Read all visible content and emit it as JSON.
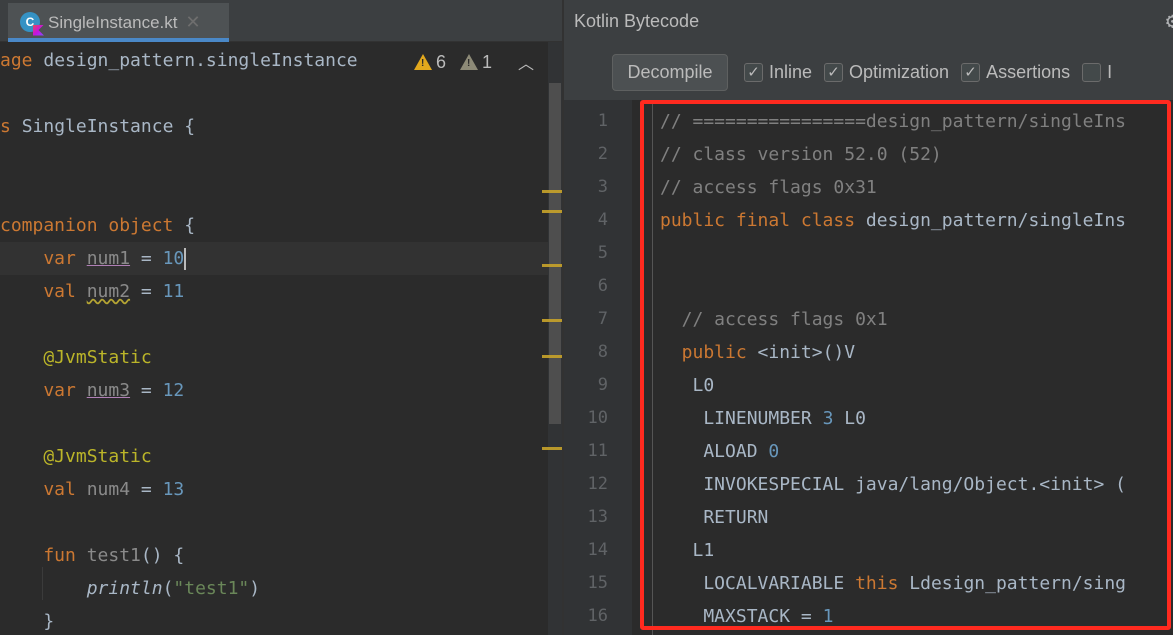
{
  "editor": {
    "tab": {
      "label": "SingleInstance.kt",
      "icon": "kotlin-class-file-icon",
      "close_icon": "close-icon"
    },
    "inspections": {
      "warnings": "6",
      "weak_warnings": "1"
    },
    "lines": [
      {
        "parts": [
          [
            "kw",
            "age "
          ],
          [
            "",
            "design_pattern.singleInstance"
          ]
        ]
      },
      {
        "parts": []
      },
      {
        "parts": [
          [
            "kw",
            "s "
          ],
          [
            "",
            "SingleInstance {"
          ]
        ]
      },
      {
        "parts": []
      },
      {
        "parts": []
      },
      {
        "parts": [
          [
            "kw",
            "companion object "
          ],
          [
            "",
            "{"
          ]
        ]
      },
      {
        "parts": [
          [
            "kw",
            "    var "
          ],
          [
            "num1",
            "num1"
          ],
          [
            "",
            " = "
          ],
          [
            "num",
            "10"
          ]
        ],
        "active": true
      },
      {
        "parts": [
          [
            "kw",
            "    val "
          ],
          [
            "num2",
            "num2"
          ],
          [
            "",
            " = "
          ],
          [
            "num",
            "11"
          ]
        ]
      },
      {
        "parts": []
      },
      {
        "parts": [
          [
            "ann",
            "    @JvmStatic"
          ]
        ]
      },
      {
        "parts": [
          [
            "kw",
            "    var "
          ],
          [
            "num3",
            "num3"
          ],
          [
            "",
            " = "
          ],
          [
            "num",
            "12"
          ]
        ]
      },
      {
        "parts": []
      },
      {
        "parts": [
          [
            "ann",
            "    @JvmStatic"
          ]
        ]
      },
      {
        "parts": [
          [
            "kw",
            "    val "
          ],
          [
            "gray",
            "num4"
          ],
          [
            "",
            " = "
          ],
          [
            "num",
            "13"
          ]
        ]
      },
      {
        "parts": []
      },
      {
        "parts": [
          [
            "kw",
            "    fun "
          ],
          [
            "gray",
            "test1"
          ],
          [
            "",
            "() {"
          ]
        ]
      },
      {
        "parts": [
          [
            "",
            "        "
          ],
          [
            "ital",
            "println"
          ],
          [
            "",
            "("
          ],
          [
            "str",
            "\"test1\""
          ],
          [
            "",
            ")"
          ]
        ]
      },
      {
        "parts": [
          [
            "",
            "    }"
          ]
        ]
      }
    ]
  },
  "bytecode_panel": {
    "title": "Kotlin Bytecode",
    "decompile_label": "Decompile",
    "options": [
      {
        "label": "Inline",
        "checked": true
      },
      {
        "label": "Optimization",
        "checked": true
      },
      {
        "label": "Assertions",
        "checked": true
      },
      {
        "label": "I",
        "checked": false
      }
    ],
    "lines": [
      {
        "n": "1",
        "parts": [
          [
            "cm",
            "// ================design_pattern/singleIns"
          ]
        ]
      },
      {
        "n": "2",
        "parts": [
          [
            "cm",
            "// class version 52.0 (52)"
          ]
        ]
      },
      {
        "n": "3",
        "parts": [
          [
            "cm",
            "// access flags 0x31"
          ]
        ]
      },
      {
        "n": "4",
        "parts": [
          [
            "kw",
            "public final class "
          ],
          [
            "",
            "design_pattern/singleIns"
          ]
        ]
      },
      {
        "n": "5",
        "parts": []
      },
      {
        "n": "6",
        "parts": []
      },
      {
        "n": "7",
        "parts": [
          [
            "cm",
            "  // access flags 0x1"
          ]
        ]
      },
      {
        "n": "8",
        "parts": [
          [
            "kw",
            "  public "
          ],
          [
            "",
            "<init>()V"
          ]
        ]
      },
      {
        "n": "9",
        "parts": [
          [
            "",
            "   L0"
          ]
        ]
      },
      {
        "n": "10",
        "parts": [
          [
            "",
            "    LINENUMBER "
          ],
          [
            "num",
            "3"
          ],
          [
            "",
            " L0"
          ]
        ]
      },
      {
        "n": "11",
        "parts": [
          [
            "",
            "    ALOAD "
          ],
          [
            "num",
            "0"
          ]
        ]
      },
      {
        "n": "12",
        "parts": [
          [
            "",
            "    INVOKESPECIAL java/lang/Object.<init> ("
          ]
        ]
      },
      {
        "n": "13",
        "parts": [
          [
            "",
            "    RETURN"
          ]
        ]
      },
      {
        "n": "14",
        "parts": [
          [
            "",
            "   L1"
          ]
        ]
      },
      {
        "n": "15",
        "parts": [
          [
            "",
            "    LOCALVARIABLE "
          ],
          [
            "kw",
            "this"
          ],
          [
            "",
            " Ldesign_pattern/sing"
          ]
        ]
      },
      {
        "n": "16",
        "parts": [
          [
            "",
            "    MAXSTACK = "
          ],
          [
            "num",
            "1"
          ]
        ]
      }
    ]
  },
  "colors": {
    "highlight_box": "#ff2a1f",
    "keyword": "#cc7832",
    "number": "#6897bb",
    "annotation": "#bbb529",
    "string": "#6a8759",
    "comment": "#808080",
    "warning": "#e2a81d",
    "tab_underline": "#4a88c7"
  }
}
